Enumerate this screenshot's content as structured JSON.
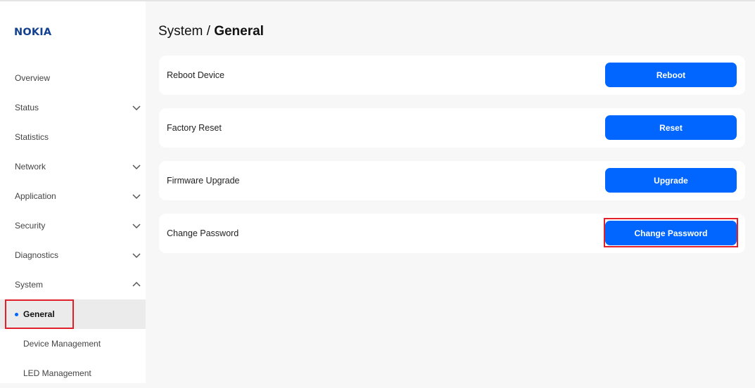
{
  "brand": {
    "logo_text": "NOKIA",
    "color": "#124191"
  },
  "accent_color": "#0066ff",
  "sidebar": {
    "items": [
      {
        "label": "Overview",
        "expandable": false
      },
      {
        "label": "Status",
        "expandable": true,
        "icon": "chevron-down-icon"
      },
      {
        "label": "Statistics",
        "expandable": false
      },
      {
        "label": "Network",
        "expandable": true,
        "icon": "chevron-down-icon"
      },
      {
        "label": "Application",
        "expandable": true,
        "icon": "chevron-down-icon"
      },
      {
        "label": "Security",
        "expandable": true,
        "icon": "chevron-down-icon"
      },
      {
        "label": "Diagnostics",
        "expandable": true,
        "icon": "chevron-down-icon"
      },
      {
        "label": "System",
        "expandable": true,
        "expanded": true,
        "icon": "chevron-up-icon"
      }
    ],
    "system_children": [
      {
        "label": "General",
        "active": true
      },
      {
        "label": "Device Management",
        "active": false
      },
      {
        "label": "LED Management",
        "active": false
      }
    ]
  },
  "header": {
    "breadcrumb_parent": "System",
    "separator": "/",
    "breadcrumb_current": "General"
  },
  "cards": [
    {
      "label": "Reboot Device",
      "button": "Reboot"
    },
    {
      "label": "Factory Reset",
      "button": "Reset"
    },
    {
      "label": "Firmware Upgrade",
      "button": "Upgrade"
    },
    {
      "label": "Change Password",
      "button": "Change Password"
    }
  ]
}
